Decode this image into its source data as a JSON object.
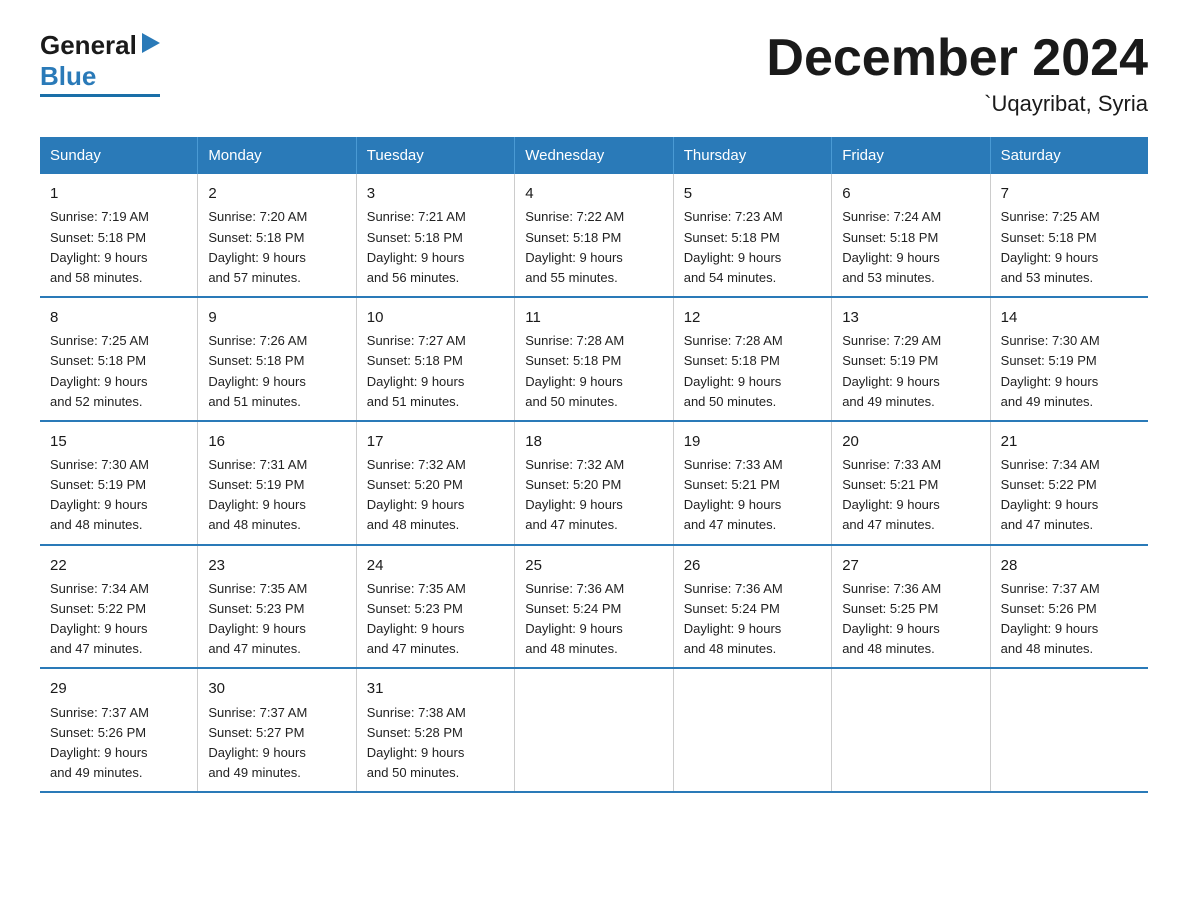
{
  "logo": {
    "general": "General",
    "triangle": "▶",
    "blue": "Blue"
  },
  "title": "December 2024",
  "subtitle": "`Uqayribat, Syria",
  "days_of_week": [
    "Sunday",
    "Monday",
    "Tuesday",
    "Wednesday",
    "Thursday",
    "Friday",
    "Saturday"
  ],
  "weeks": [
    [
      {
        "day": "1",
        "sunrise": "7:19 AM",
        "sunset": "5:18 PM",
        "daylight": "9 hours and 58 minutes."
      },
      {
        "day": "2",
        "sunrise": "7:20 AM",
        "sunset": "5:18 PM",
        "daylight": "9 hours and 57 minutes."
      },
      {
        "day": "3",
        "sunrise": "7:21 AM",
        "sunset": "5:18 PM",
        "daylight": "9 hours and 56 minutes."
      },
      {
        "day": "4",
        "sunrise": "7:22 AM",
        "sunset": "5:18 PM",
        "daylight": "9 hours and 55 minutes."
      },
      {
        "day": "5",
        "sunrise": "7:23 AM",
        "sunset": "5:18 PM",
        "daylight": "9 hours and 54 minutes."
      },
      {
        "day": "6",
        "sunrise": "7:24 AM",
        "sunset": "5:18 PM",
        "daylight": "9 hours and 53 minutes."
      },
      {
        "day": "7",
        "sunrise": "7:25 AM",
        "sunset": "5:18 PM",
        "daylight": "9 hours and 53 minutes."
      }
    ],
    [
      {
        "day": "8",
        "sunrise": "7:25 AM",
        "sunset": "5:18 PM",
        "daylight": "9 hours and 52 minutes."
      },
      {
        "day": "9",
        "sunrise": "7:26 AM",
        "sunset": "5:18 PM",
        "daylight": "9 hours and 51 minutes."
      },
      {
        "day": "10",
        "sunrise": "7:27 AM",
        "sunset": "5:18 PM",
        "daylight": "9 hours and 51 minutes."
      },
      {
        "day": "11",
        "sunrise": "7:28 AM",
        "sunset": "5:18 PM",
        "daylight": "9 hours and 50 minutes."
      },
      {
        "day": "12",
        "sunrise": "7:28 AM",
        "sunset": "5:18 PM",
        "daylight": "9 hours and 50 minutes."
      },
      {
        "day": "13",
        "sunrise": "7:29 AM",
        "sunset": "5:19 PM",
        "daylight": "9 hours and 49 minutes."
      },
      {
        "day": "14",
        "sunrise": "7:30 AM",
        "sunset": "5:19 PM",
        "daylight": "9 hours and 49 minutes."
      }
    ],
    [
      {
        "day": "15",
        "sunrise": "7:30 AM",
        "sunset": "5:19 PM",
        "daylight": "9 hours and 48 minutes."
      },
      {
        "day": "16",
        "sunrise": "7:31 AM",
        "sunset": "5:19 PM",
        "daylight": "9 hours and 48 minutes."
      },
      {
        "day": "17",
        "sunrise": "7:32 AM",
        "sunset": "5:20 PM",
        "daylight": "9 hours and 48 minutes."
      },
      {
        "day": "18",
        "sunrise": "7:32 AM",
        "sunset": "5:20 PM",
        "daylight": "9 hours and 47 minutes."
      },
      {
        "day": "19",
        "sunrise": "7:33 AM",
        "sunset": "5:21 PM",
        "daylight": "9 hours and 47 minutes."
      },
      {
        "day": "20",
        "sunrise": "7:33 AM",
        "sunset": "5:21 PM",
        "daylight": "9 hours and 47 minutes."
      },
      {
        "day": "21",
        "sunrise": "7:34 AM",
        "sunset": "5:22 PM",
        "daylight": "9 hours and 47 minutes."
      }
    ],
    [
      {
        "day": "22",
        "sunrise": "7:34 AM",
        "sunset": "5:22 PM",
        "daylight": "9 hours and 47 minutes."
      },
      {
        "day": "23",
        "sunrise": "7:35 AM",
        "sunset": "5:23 PM",
        "daylight": "9 hours and 47 minutes."
      },
      {
        "day": "24",
        "sunrise": "7:35 AM",
        "sunset": "5:23 PM",
        "daylight": "9 hours and 47 minutes."
      },
      {
        "day": "25",
        "sunrise": "7:36 AM",
        "sunset": "5:24 PM",
        "daylight": "9 hours and 48 minutes."
      },
      {
        "day": "26",
        "sunrise": "7:36 AM",
        "sunset": "5:24 PM",
        "daylight": "9 hours and 48 minutes."
      },
      {
        "day": "27",
        "sunrise": "7:36 AM",
        "sunset": "5:25 PM",
        "daylight": "9 hours and 48 minutes."
      },
      {
        "day": "28",
        "sunrise": "7:37 AM",
        "sunset": "5:26 PM",
        "daylight": "9 hours and 48 minutes."
      }
    ],
    [
      {
        "day": "29",
        "sunrise": "7:37 AM",
        "sunset": "5:26 PM",
        "daylight": "9 hours and 49 minutes."
      },
      {
        "day": "30",
        "sunrise": "7:37 AM",
        "sunset": "5:27 PM",
        "daylight": "9 hours and 49 minutes."
      },
      {
        "day": "31",
        "sunrise": "7:38 AM",
        "sunset": "5:28 PM",
        "daylight": "9 hours and 50 minutes."
      },
      null,
      null,
      null,
      null
    ]
  ]
}
